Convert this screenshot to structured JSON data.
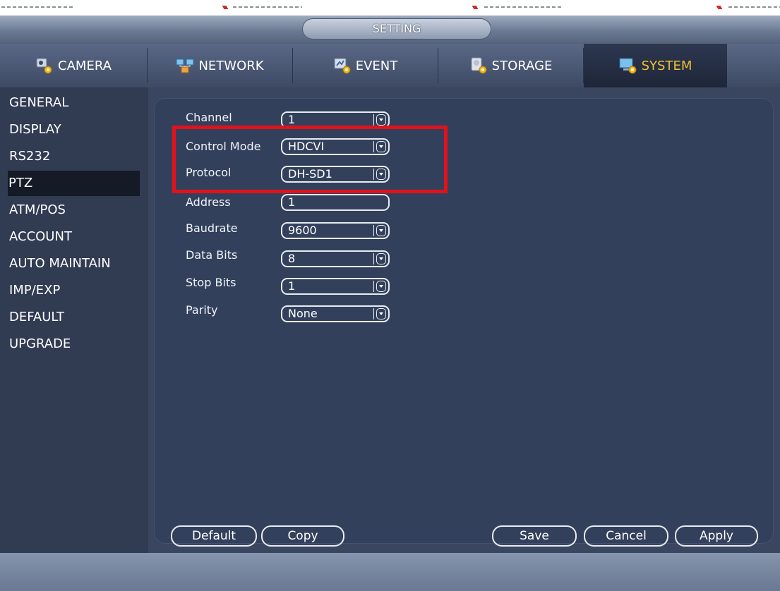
{
  "window": {
    "title": "SETTING"
  },
  "tabs": [
    {
      "label": "CAMERA",
      "icon": "camera-icon",
      "active": false
    },
    {
      "label": "NETWORK",
      "icon": "network-icon",
      "active": false
    },
    {
      "label": "EVENT",
      "icon": "event-icon",
      "active": false
    },
    {
      "label": "STORAGE",
      "icon": "storage-icon",
      "active": false
    },
    {
      "label": "SYSTEM",
      "icon": "system-icon",
      "active": true
    }
  ],
  "sidebar": {
    "items": [
      {
        "label": "GENERAL"
      },
      {
        "label": "DISPLAY"
      },
      {
        "label": "RS232"
      },
      {
        "label": "PTZ",
        "active": true
      },
      {
        "label": "ATM/POS"
      },
      {
        "label": "ACCOUNT"
      },
      {
        "label": "AUTO MAINTAIN"
      },
      {
        "label": "IMP/EXP"
      },
      {
        "label": "DEFAULT"
      },
      {
        "label": "UPGRADE"
      }
    ]
  },
  "form": {
    "fields": [
      {
        "label": "Channel",
        "value": "1",
        "dropdown": true
      },
      {
        "label": "Control Mode",
        "value": "HDCVI",
        "dropdown": true
      },
      {
        "label": "Protocol",
        "value": "DH-SD1",
        "dropdown": true
      },
      {
        "label": "Address",
        "value": "1",
        "dropdown": false
      },
      {
        "label": "Baudrate",
        "value": "9600",
        "dropdown": true
      },
      {
        "label": "Data Bits",
        "value": "8",
        "dropdown": true
      },
      {
        "label": "Stop Bits",
        "value": "1",
        "dropdown": true
      },
      {
        "label": "Parity",
        "value": "None",
        "dropdown": true
      }
    ]
  },
  "buttons": {
    "default": "Default",
    "copy": "Copy",
    "save": "Save",
    "cancel": "Cancel",
    "apply": "Apply"
  },
  "colors": {
    "active_tab_text": "#f2c230",
    "highlight_box": "#e3111b",
    "panel_bg": "#33405c"
  }
}
